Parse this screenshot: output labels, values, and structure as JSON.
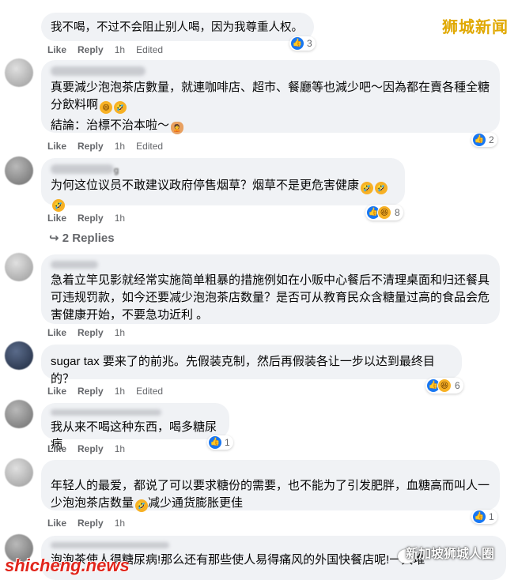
{
  "watermark": {
    "top": "狮城新闻",
    "bottom": "shicheng.news",
    "wechat": "新加坡狮城人圈"
  },
  "actions": {
    "like": "Like",
    "reply": "Reply",
    "time": "1h",
    "edited": "Edited"
  },
  "comments": [
    {
      "text": "我不喝，不过不会阻止别人喝，因为我尊重人权。",
      "reactions": "3"
    },
    {
      "text": "真要減少泡泡茶店數量，就連咖啡店、超市、餐廳等也減少吧～因為都在賣各種全糖分飲料啊",
      "text2": "結論：治標不治本啦～",
      "reactions": "2"
    },
    {
      "name_tail": "g",
      "text": "为何这位议员不敢建议政府停售烟草？烟草不是更危害健康",
      "reactions": "8",
      "replies": "2 Replies"
    },
    {
      "text": "急着立竿见影就经常实施简单粗暴的措施例如在小贩中心餐后不清理桌面和归还餐具可违规罚款，如今还要减少泡泡茶店数量？是否可从教育民众含糖量过高的食品会危害健康开始，不要急功近利 。"
    },
    {
      "text": "sugar tax 要来了的前兆。先假装克制，然后再假装各让一步以达到最终目的？",
      "reactions": "6"
    },
    {
      "text": "我从来不喝这种东西，喝多糖尿病",
      "reactions": "1"
    },
    {
      "text": "年轻人的最爱，都说了可以要求糖份的需要，也不能为了引发肥胖，血糖高而叫人一少泡泡茶店数量",
      "text_tail": "减少通货膨胀更佳",
      "reactions": "1"
    },
    {
      "text": "泡泡茶使人得糖尿病!那么还有那些使人易得痛风的外国快餐店呢!一大堆"
    }
  ]
}
